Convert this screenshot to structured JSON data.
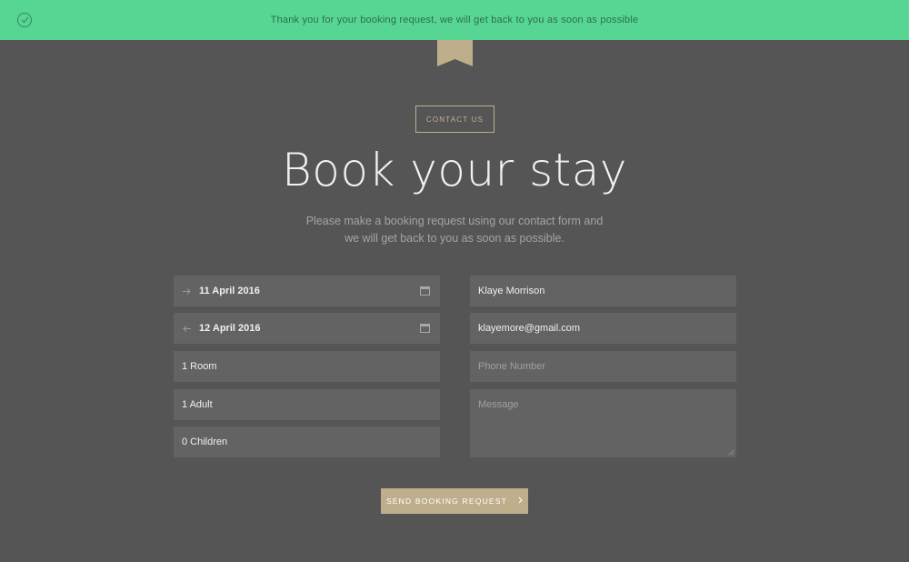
{
  "notice": {
    "message": "Thank you for your booking request, we will get back to you as soon as possible",
    "icon": "check-circle-icon",
    "bg_color": "#57d693"
  },
  "header": {
    "eyebrow": "CONTACT US",
    "title": "Book your stay",
    "subtitle_line1": "Please make a booking request using our contact form and",
    "subtitle_line2": "we will get back to you as soon as possible."
  },
  "form": {
    "check_in": {
      "value": "11 April 2016",
      "icon": "arrow-right-icon"
    },
    "check_out": {
      "value": "12 April 2016",
      "icon": "arrow-left-icon"
    },
    "rooms": {
      "value": "1 Room"
    },
    "adults": {
      "value": "1 Adult"
    },
    "children": {
      "value": "0 Children"
    },
    "name": {
      "value": "Klaye Morrison"
    },
    "email": {
      "value": "klayemore@gmail.com"
    },
    "phone": {
      "value": "",
      "placeholder": "Phone Number"
    },
    "message": {
      "value": "",
      "placeholder": "Message"
    }
  },
  "submit": {
    "label": "SEND BOOKING REQUEST",
    "icon": "chevron-right-icon",
    "color": "#bfae8c"
  }
}
